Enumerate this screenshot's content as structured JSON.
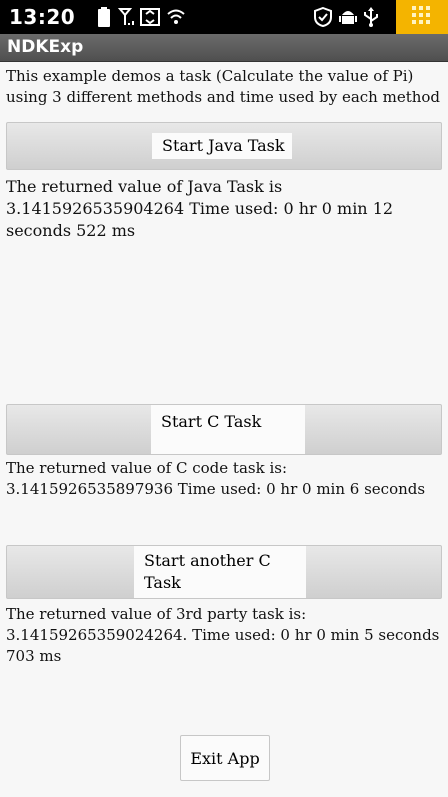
{
  "status_bar": {
    "time": "13:20",
    "icons": [
      "battery-icon",
      "signal-icon",
      "data-icon",
      "wifi-icon",
      "shield-icon",
      "android-icon",
      "usb-icon",
      "app-grid-icon"
    ]
  },
  "app": {
    "title": "NDKExp",
    "intro": "This example demos a task (Calculate the value of Pi) using 3 different methods and time used by each method"
  },
  "java_task": {
    "button_label": "Start Java Task",
    "result": "The returned value of Java Task is 3.1415926535904264 Time used: 0 hr 0 min 12 seconds 522 ms"
  },
  "c_task": {
    "button_label": "Start C Task",
    "result": "The returned value of C code task is: 3.1415926535897936 Time used: 0 hr 0 min 6 seconds"
  },
  "third_party_task": {
    "button_label": "Start another C Task",
    "result": "The returned value of 3rd party task is: 3.14159265359024264. Time used: 0 hr 0 min 5 seconds 703 ms"
  },
  "exit": {
    "button_label": "Exit App"
  }
}
